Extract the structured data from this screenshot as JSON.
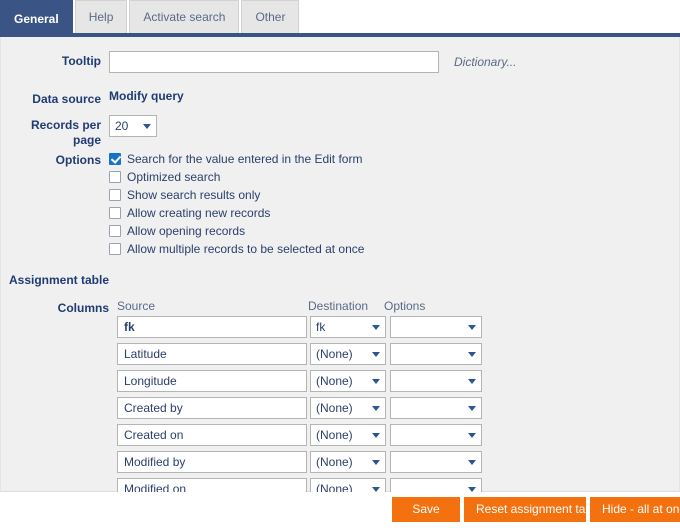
{
  "tabs": [
    {
      "label": "General",
      "active": true
    },
    {
      "label": "Help",
      "active": false
    },
    {
      "label": "Activate search",
      "active": false
    },
    {
      "label": "Other",
      "active": false
    }
  ],
  "form": {
    "tooltip": {
      "label": "Tooltip",
      "value": "",
      "placeholder": "",
      "dictionary_link": "Dictionary..."
    },
    "data_source": {
      "label": "Data source",
      "link": "Modify query"
    },
    "records_per_page": {
      "label": "Records per page",
      "value": "20"
    },
    "options": {
      "label": "Options",
      "items": [
        {
          "label": "Search for the value entered in the Edit form",
          "checked": true
        },
        {
          "label": "Optimized search",
          "checked": false
        },
        {
          "label": "Show search results only",
          "checked": false
        },
        {
          "label": "Allow creating new records",
          "checked": false
        },
        {
          "label": "Allow opening records",
          "checked": false
        },
        {
          "label": "Allow multiple records to be selected at once",
          "checked": false
        }
      ]
    }
  },
  "assignment_table": {
    "heading": "Assignment table",
    "columns_label": "Columns",
    "headers": {
      "source": "Source",
      "destination": "Destination",
      "options": "Options"
    },
    "rows": [
      {
        "source": "fk",
        "bold": true,
        "destination": "fk",
        "options": ""
      },
      {
        "source": "Latitude",
        "bold": false,
        "destination": "(None)",
        "options": ""
      },
      {
        "source": "Longitude",
        "bold": false,
        "destination": "(None)",
        "options": ""
      },
      {
        "source": "Created by",
        "bold": false,
        "destination": "(None)",
        "options": ""
      },
      {
        "source": "Created on",
        "bold": false,
        "destination": "(None)",
        "options": ""
      },
      {
        "source": "Modified by",
        "bold": false,
        "destination": "(None)",
        "options": ""
      },
      {
        "source": "Modified on",
        "bold": false,
        "destination": "(None)",
        "options": ""
      }
    ]
  },
  "footer": {
    "buttons": [
      {
        "label": "Save"
      },
      {
        "label": "Reset assignment table"
      },
      {
        "label": "Hide - all at once"
      }
    ]
  },
  "colors": {
    "tab_active_bg": "#3a5486",
    "panel_bg": "#f0f0f0",
    "label_text": "#1f3b73",
    "muted_text": "#5a6a85",
    "checkbox_checked": "#1573c8",
    "button_orange": "#f4710f"
  }
}
